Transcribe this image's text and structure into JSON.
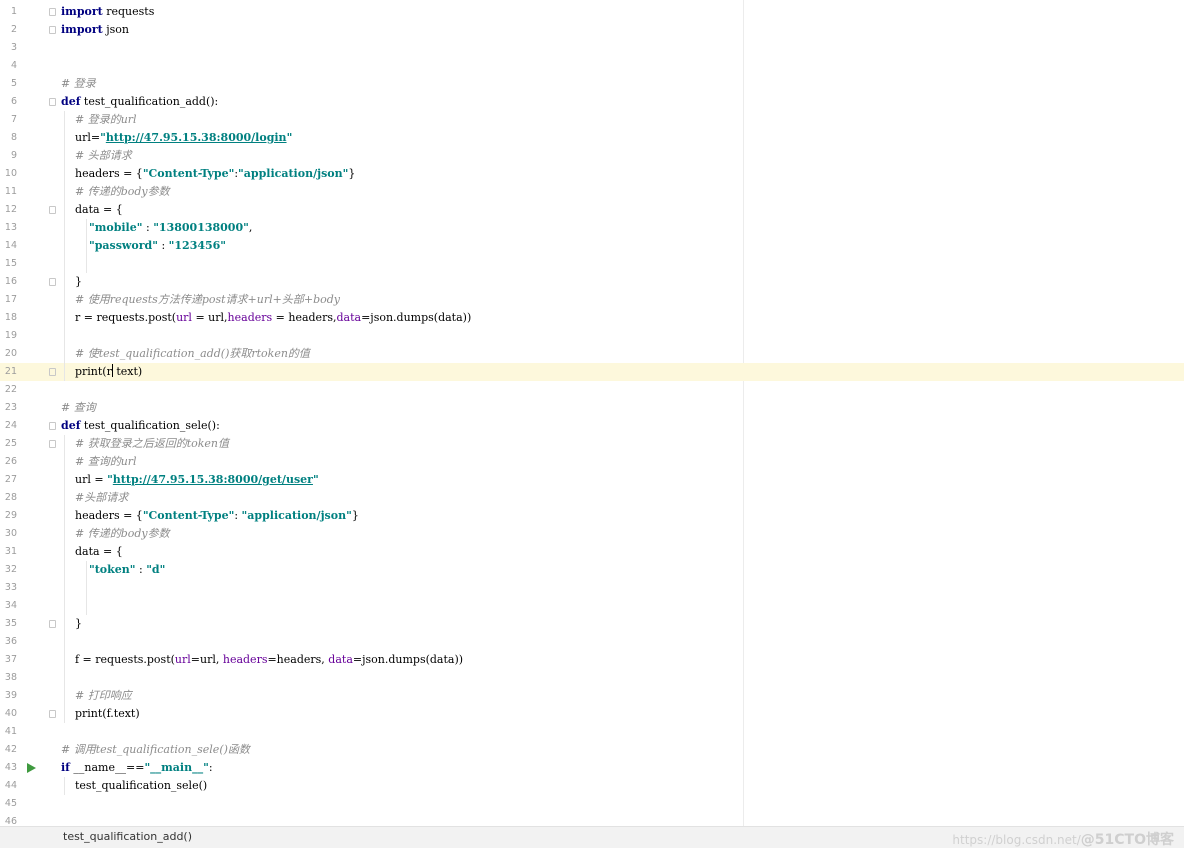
{
  "editor": {
    "current_line": 21,
    "lines": [
      {
        "n": "1",
        "tokens": [
          [
            "kw",
            "import"
          ],
          [
            "t",
            " requests"
          ]
        ]
      },
      {
        "n": "2",
        "tokens": [
          [
            "kw",
            "import"
          ],
          [
            "t",
            " json"
          ]
        ]
      },
      {
        "n": "3",
        "tokens": []
      },
      {
        "n": "4",
        "tokens": []
      },
      {
        "n": "5",
        "tokens": [
          [
            "cm",
            "# 登录"
          ]
        ]
      },
      {
        "n": "6",
        "tokens": [
          [
            "kw",
            "def"
          ],
          [
            "t",
            " test_qualification_add():"
          ]
        ]
      },
      {
        "n": "7",
        "tokens": [
          [
            "t",
            "    "
          ],
          [
            "cm",
            "# 登录的url"
          ]
        ]
      },
      {
        "n": "8",
        "tokens": [
          [
            "t",
            "    url="
          ],
          [
            "str",
            "\""
          ],
          [
            "url",
            "http://47.95.15.38:8000/login"
          ],
          [
            "str",
            "\""
          ]
        ]
      },
      {
        "n": "9",
        "tokens": [
          [
            "t",
            "    "
          ],
          [
            "cm",
            "# 头部请求"
          ]
        ]
      },
      {
        "n": "10",
        "tokens": [
          [
            "t",
            "    headers = {"
          ],
          [
            "str",
            "\"Content-Type\""
          ],
          [
            "t",
            ":"
          ],
          [
            "str",
            "\"application/json\""
          ],
          [
            "t",
            "}"
          ]
        ]
      },
      {
        "n": "11",
        "tokens": [
          [
            "t",
            "    "
          ],
          [
            "cm",
            "# 传递的body参数"
          ]
        ]
      },
      {
        "n": "12",
        "tokens": [
          [
            "t",
            "    data = {"
          ]
        ]
      },
      {
        "n": "13",
        "tokens": [
          [
            "t",
            "        "
          ],
          [
            "str",
            "\"mobile\""
          ],
          [
            "t",
            " : "
          ],
          [
            "str",
            "\"13800138000\""
          ],
          [
            "t",
            ","
          ]
        ]
      },
      {
        "n": "14",
        "tokens": [
          [
            "t",
            "        "
          ],
          [
            "str",
            "\"password\""
          ],
          [
            "t",
            " : "
          ],
          [
            "str",
            "\"123456\""
          ]
        ]
      },
      {
        "n": "15",
        "tokens": []
      },
      {
        "n": "16",
        "tokens": [
          [
            "t",
            "    }"
          ]
        ]
      },
      {
        "n": "17",
        "tokens": [
          [
            "t",
            "    "
          ],
          [
            "cm",
            "# 使用requests方法传递post请求+url+头部+body"
          ]
        ]
      },
      {
        "n": "18",
        "tokens": [
          [
            "t",
            "    r = requests.post("
          ],
          [
            "pm",
            "url"
          ],
          [
            "t",
            " = url,"
          ],
          [
            "pm",
            "headers"
          ],
          [
            "t",
            " = headers,"
          ],
          [
            "pm",
            "data"
          ],
          [
            "t",
            "=json.dumps(data))"
          ]
        ]
      },
      {
        "n": "19",
        "tokens": []
      },
      {
        "n": "20",
        "tokens": [
          [
            "t",
            "    "
          ],
          [
            "cm",
            "# 使test_qualification_add()获取rtoken的值"
          ]
        ]
      },
      {
        "n": "21",
        "tokens": [
          [
            "t",
            "    print(r"
          ],
          [
            "caret",
            ""
          ],
          [
            "t",
            " text)"
          ]
        ]
      },
      {
        "n": "22",
        "tokens": []
      },
      {
        "n": "23",
        "tokens": [
          [
            "cm",
            "# 查询"
          ]
        ]
      },
      {
        "n": "24",
        "tokens": [
          [
            "kw",
            "def"
          ],
          [
            "t",
            " test_qualification_sele():"
          ]
        ]
      },
      {
        "n": "25",
        "tokens": [
          [
            "t",
            "    "
          ],
          [
            "cm",
            "# 获取登录之后返回的token值"
          ]
        ]
      },
      {
        "n": "26",
        "tokens": [
          [
            "t",
            "    "
          ],
          [
            "cm",
            "# 查询的url"
          ]
        ]
      },
      {
        "n": "27",
        "tokens": [
          [
            "t",
            "    url = "
          ],
          [
            "str",
            "\""
          ],
          [
            "url",
            "http://47.95.15.38:8000/get/user"
          ],
          [
            "str",
            "\""
          ]
        ]
      },
      {
        "n": "28",
        "tokens": [
          [
            "t",
            "    "
          ],
          [
            "cm",
            "#头部请求"
          ]
        ]
      },
      {
        "n": "29",
        "tokens": [
          [
            "t",
            "    headers = {"
          ],
          [
            "str",
            "\"Content-Type\""
          ],
          [
            "t",
            ": "
          ],
          [
            "str",
            "\"application/json\""
          ],
          [
            "t",
            "}"
          ]
        ]
      },
      {
        "n": "30",
        "tokens": [
          [
            "t",
            "    "
          ],
          [
            "cm",
            "# 传递的body参数"
          ]
        ]
      },
      {
        "n": "31",
        "tokens": [
          [
            "t",
            "    data = {"
          ]
        ]
      },
      {
        "n": "32",
        "tokens": [
          [
            "t",
            "        "
          ],
          [
            "str",
            "\"token\""
          ],
          [
            "t",
            " : "
          ],
          [
            "str",
            "\"d\""
          ]
        ]
      },
      {
        "n": "33",
        "tokens": []
      },
      {
        "n": "34",
        "tokens": []
      },
      {
        "n": "35",
        "tokens": [
          [
            "t",
            "    }"
          ]
        ]
      },
      {
        "n": "36",
        "tokens": []
      },
      {
        "n": "37",
        "tokens": [
          [
            "t",
            "    f = requests.post("
          ],
          [
            "pm",
            "url"
          ],
          [
            "t",
            "=url, "
          ],
          [
            "pm",
            "headers"
          ],
          [
            "t",
            "=headers, "
          ],
          [
            "pm",
            "data"
          ],
          [
            "t",
            "=json.dumps(data))"
          ]
        ]
      },
      {
        "n": "38",
        "tokens": []
      },
      {
        "n": "39",
        "tokens": [
          [
            "t",
            "    "
          ],
          [
            "cm",
            "# 打印响应"
          ]
        ]
      },
      {
        "n": "40",
        "tokens": [
          [
            "t",
            "    print(f.text)"
          ]
        ]
      },
      {
        "n": "41",
        "tokens": []
      },
      {
        "n": "42",
        "tokens": [
          [
            "cm",
            "# 调用test_qualification_sele()函数"
          ]
        ]
      },
      {
        "n": "43",
        "tokens": [
          [
            "kw",
            "if"
          ],
          [
            "t",
            " __name__=="
          ],
          [
            "str",
            "\"__main__\""
          ],
          [
            "t",
            ":"
          ]
        ]
      },
      {
        "n": "44",
        "tokens": [
          [
            "t",
            "    test_qualification_sele()"
          ]
        ]
      },
      {
        "n": "45",
        "tokens": []
      },
      {
        "n": "46",
        "tokens": []
      }
    ]
  },
  "statusbar": {
    "breadcrumb": "test_qualification_add()",
    "watermark_text": "https://blog.csdn.net/",
    "watermark_brand": "@51CTO博客"
  },
  "colors": {
    "keyword": "#000080",
    "string": "#008080",
    "comment": "#8c8c8c",
    "param": "#660099",
    "current_line_bg": "#fdf8dc",
    "run_icon": "#3f9a3f"
  }
}
